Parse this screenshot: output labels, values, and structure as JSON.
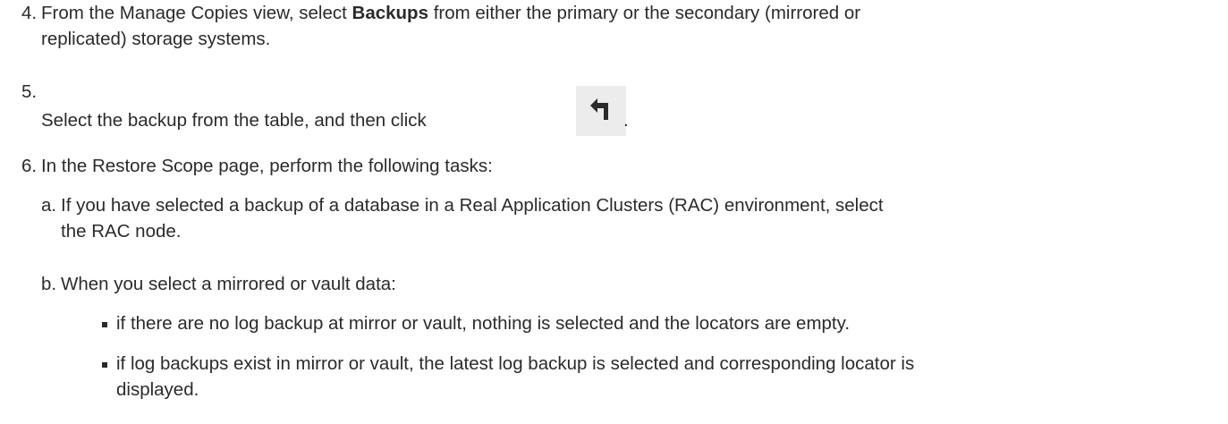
{
  "steps": [
    {
      "number": "4.",
      "text_before": "From the Manage Copies view, select ",
      "bold": "Backups",
      "text_after": " from either the primary or the secondary (mirrored or",
      "continuation": "replicated) storage systems."
    },
    {
      "number": "5.",
      "text_before": "Select the backup from the table, and then click",
      "icon": "restore-arrow-icon",
      "text_after": "."
    },
    {
      "number": "6.",
      "text": "In the Restore Scope page, perform the following tasks:",
      "substeps": [
        {
          "letter": "a.",
          "line1": "If you have selected a backup of a database in a Real Application Clusters (RAC) environment, select",
          "line2": "the RAC node."
        },
        {
          "letter": "b.",
          "line1": "When you select a mirrored or vault data:",
          "bullets": [
            {
              "line1": "if there are no log backup at mirror or vault, nothing is selected and the locators are empty."
            },
            {
              "line1": "if log backups exist in mirror or vault, the latest log backup is selected and corresponding locator is",
              "line2": "displayed."
            }
          ]
        }
      ]
    }
  ],
  "colors": {
    "text": "#2b2b2b",
    "icon_bg": "#ececec",
    "icon_fg": "#2b2b2b"
  }
}
